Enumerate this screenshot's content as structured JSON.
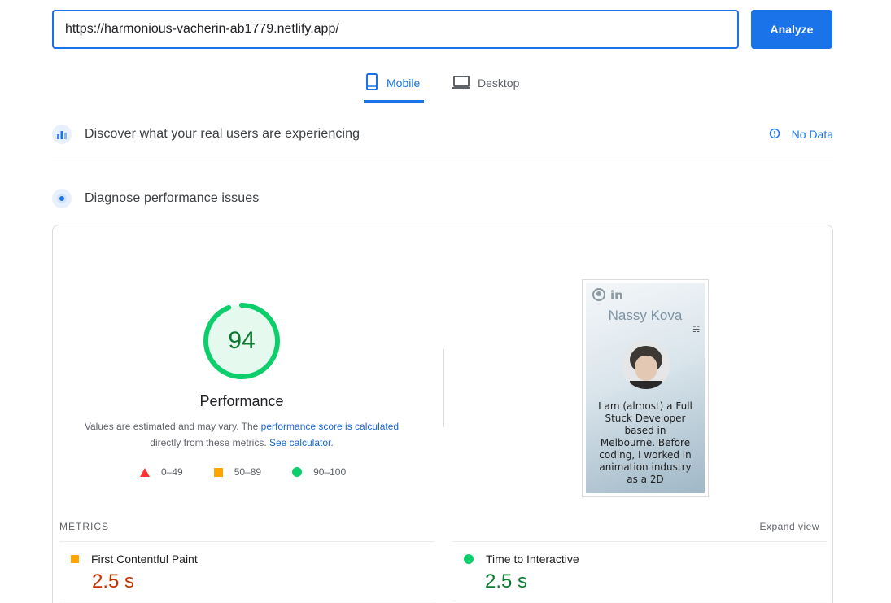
{
  "search": {
    "url_value": "https://harmonious-vacherin-ab1779.netlify.app/",
    "analyze_label": "Analyze"
  },
  "tabs": [
    {
      "label": "Mobile",
      "active": true,
      "icon": "phone-icon"
    },
    {
      "label": "Desktop",
      "active": false,
      "icon": "laptop-icon"
    }
  ],
  "real_users": {
    "title": "Discover what your real users are experiencing",
    "status": "No Data",
    "icon": "crux-chart-icon"
  },
  "diagnose": {
    "title": "Diagnose performance issues",
    "icon": "lighthouse-icon"
  },
  "performance": {
    "score": "94",
    "score_fraction": 0.94,
    "title": "Performance",
    "desc_prefix": "Values are estimated and may vary. The ",
    "desc_link1": "performance score is calculated",
    "desc_middle": "directly from these metrics. ",
    "desc_link2": "See calculator",
    "desc_suffix": ".",
    "legend": [
      {
        "range": "0–49",
        "shape": "triangle",
        "color": "#ff3333"
      },
      {
        "range": "50–89",
        "shape": "square",
        "color": "#ffa400"
      },
      {
        "range": "90–100",
        "shape": "circle",
        "color": "#0cce6b"
      }
    ]
  },
  "screenshot": {
    "name": "Nassy Kova",
    "bio": "I am (almost) a Full Stuck Developer based in Melbourne. Before coding, I worked in animation industry as a 2D"
  },
  "metrics": {
    "label": "METRICS",
    "expand": "Expand view",
    "items": [
      {
        "name": "First Contentful Paint",
        "value": "2.5 s",
        "rating": "average",
        "color": "#c33300"
      },
      {
        "name": "Time to Interactive",
        "value": "2.5 s",
        "rating": "pass",
        "color": "#0a7c2f"
      }
    ]
  },
  "colors": {
    "accent": "#1a73e8",
    "pass": "#0cce6b",
    "average": "#ffa400",
    "fail": "#ff3333"
  }
}
